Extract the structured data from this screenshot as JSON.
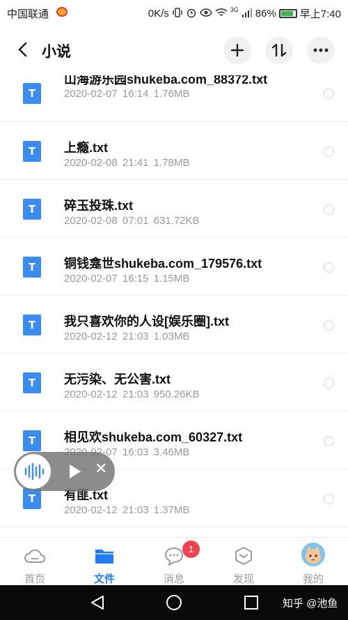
{
  "status_bar": {
    "carrier": "中国联通",
    "speed": "0K/s",
    "network": "3G",
    "battery": "86%",
    "battery_level": 0.86,
    "time": "早上7:40",
    "icons": [
      "weibo-icon",
      "vibrate-icon",
      "alarm-icon",
      "eye-icon",
      "wifi-icon",
      "signal-icon",
      "battery-icon"
    ]
  },
  "header": {
    "back_icon": "chevron-left-icon",
    "title": "小说",
    "actions": [
      "add-icon",
      "sort-icon",
      "more-icon"
    ]
  },
  "file_icon_letter": "T",
  "files": [
    {
      "name": "山海游乐园shukeba.com_88372.txt",
      "date": "2020-02-07",
      "time": "16:14",
      "size": "1.76MB"
    },
    {
      "name": "上瘾.txt",
      "date": "2020-02-08",
      "time": "21:41",
      "size": "1.78MB"
    },
    {
      "name": "碎玉投珠.txt",
      "date": "2020-02-08",
      "time": "07:01",
      "size": "631.72KB"
    },
    {
      "name": "铜钱龛世shukeba.com_179576.txt",
      "date": "2020-02-07",
      "time": "16:15",
      "size": "1.15MB"
    },
    {
      "name": "我只喜欢你的人设[娱乐圈].txt",
      "date": "2020-02-12",
      "time": "21:03",
      "size": "1.03MB"
    },
    {
      "name": "无污染、无公害.txt",
      "date": "2020-02-12",
      "time": "21:03",
      "size": "950.26KB"
    },
    {
      "name": "相见欢shukeba.com_60327.txt",
      "date": "2020-02-07",
      "time": "16:03",
      "size": "3.46MB"
    },
    {
      "name": "有匪.txt",
      "date": "2020-02-12",
      "time": "21:03",
      "size": "1.37MB"
    }
  ],
  "player": {
    "icons": [
      "audio-wave-icon",
      "play-icon",
      "close-icon"
    ]
  },
  "bottom_nav": {
    "items": [
      {
        "label": "首页",
        "icon": "cloud-icon"
      },
      {
        "label": "文件",
        "icon": "folder-icon",
        "active": true
      },
      {
        "label": "消息",
        "icon": "chat-icon",
        "badge": "1"
      },
      {
        "label": "发现",
        "icon": "cube-icon"
      },
      {
        "label": "我的",
        "icon": "avatar-icon"
      }
    ]
  },
  "system_nav": {
    "watermark": "知乎 @池鱼"
  },
  "colors": {
    "accent": "#1e7cf0",
    "file_icon": "#3a8cf0",
    "badge": "#f0454f"
  }
}
